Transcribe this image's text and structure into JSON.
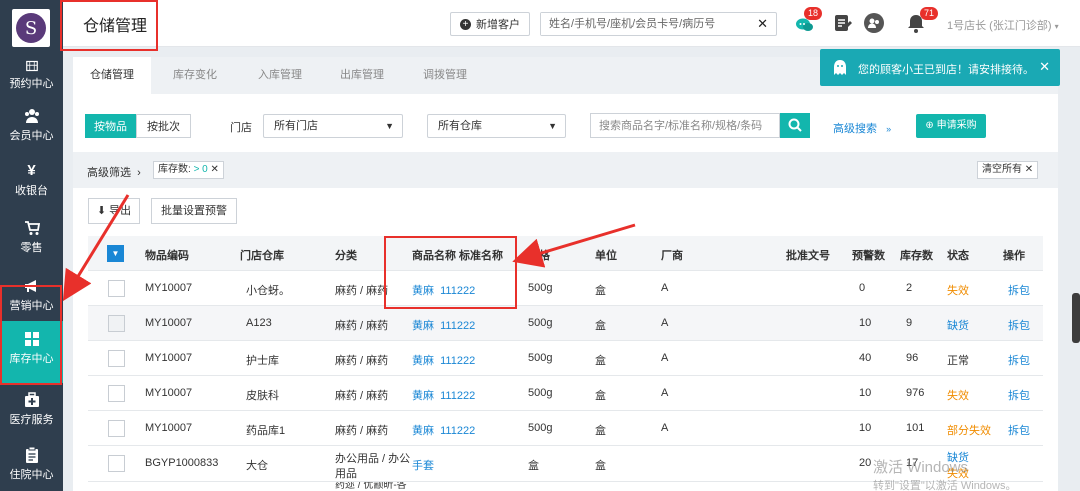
{
  "app": {
    "logo_letter": "S"
  },
  "sidebar": {
    "items": [
      {
        "key": "appointment",
        "label": "预约中心",
        "icon": "calendar-icon"
      },
      {
        "key": "member",
        "label": "会员中心",
        "icon": "users-icon"
      },
      {
        "key": "cashier",
        "label": "收银台",
        "icon": "yen-icon"
      },
      {
        "key": "retail",
        "label": "零售",
        "icon": "cart-icon"
      },
      {
        "key": "marketing",
        "label": "营销中心",
        "icon": "megaphone-icon"
      },
      {
        "key": "inventory",
        "label": "库存中心",
        "icon": "grid-icon",
        "active": true
      },
      {
        "key": "medical",
        "label": "医疗服务",
        "icon": "medkit-icon"
      },
      {
        "key": "inpatient",
        "label": "住院中心",
        "icon": "clipboard-icon"
      }
    ]
  },
  "header": {
    "title": "仓储管理",
    "add_customer": "新增客户",
    "search_placeholder": "姓名/手机号/座机/会员卡号/病历号",
    "chat_badge": "18",
    "bell_badge": "71",
    "user": "1号店长 (张江门诊部)"
  },
  "toast": {
    "message": "您的顾客小王已到店！请安排接待。"
  },
  "tabs": [
    "仓储管理",
    "库存变化",
    "入库管理",
    "出库管理",
    "调拨管理"
  ],
  "toolbar": {
    "by_item": "按物品",
    "by_batch": "按批次",
    "store_label": "门店",
    "store_select": "所有门店",
    "warehouse_select": "所有仓库",
    "product_search_placeholder": "搜索商品名字/标准名称/规格/条码",
    "advanced_search": "高级搜索",
    "apply_purchase": "申请采购"
  },
  "filter": {
    "label": "高级筛选",
    "chip_key": "库存数:",
    "chip_value": "> 0",
    "clear_all": "清空所有"
  },
  "actions": {
    "export": "导出",
    "batch_alert": "批量设置预警"
  },
  "table": {
    "headers": [
      "物品编码",
      "门店仓库",
      "分类",
      "商品名称 标准名称",
      "规格",
      "单位",
      "厂商",
      "批准文号",
      "预警数",
      "库存数",
      "状态",
      "操作"
    ],
    "rows": [
      {
        "code": "MY10007",
        "store": "小仓蚜。",
        "category": "麻药 / 麻药",
        "name": "黄麻",
        "std_name": "111222",
        "spec": "500g",
        "unit": "盒",
        "vendor": "A",
        "approval": "",
        "alert": "0",
        "stock": "2",
        "status": "失效",
        "status_color": "#f08c00",
        "op": "拆包"
      },
      {
        "code": "MY10007",
        "store": "A123",
        "category": "麻药 / 麻药",
        "name": "黄麻",
        "std_name": "111222",
        "spec": "500g",
        "unit": "盒",
        "vendor": "A",
        "approval": "",
        "alert": "10",
        "stock": "9",
        "status": "缺货",
        "status_color": "#1a87d5",
        "op": "拆包"
      },
      {
        "code": "MY10007",
        "store": "护士库",
        "category": "麻药 / 麻药",
        "name": "黄麻",
        "std_name": "111222",
        "spec": "500g",
        "unit": "盒",
        "vendor": "A",
        "approval": "",
        "alert": "40",
        "stock": "96",
        "status": "正常",
        "status_color": "#333333",
        "op": "拆包"
      },
      {
        "code": "MY10007",
        "store": "皮肤科",
        "category": "麻药 / 麻药",
        "name": "黄麻",
        "std_name": "111222",
        "spec": "500g",
        "unit": "盒",
        "vendor": "A",
        "approval": "",
        "alert": "10",
        "stock": "976",
        "status": "失效",
        "status_color": "#f08c00",
        "op": "拆包"
      },
      {
        "code": "MY10007",
        "store": "药品库1",
        "category": "麻药 / 麻药",
        "name": "黄麻",
        "std_name": "111222",
        "spec": "500g",
        "unit": "盒",
        "vendor": "A",
        "approval": "",
        "alert": "10",
        "stock": "101",
        "status": "部分失效",
        "status_color": "#f08c00",
        "op": "拆包"
      },
      {
        "code": "BGYP1000833",
        "store": "大仓",
        "category": "办公用品 / 办公",
        "category2": "用品",
        "name": "手套",
        "std_name": "",
        "spec": "盒",
        "unit": "盒",
        "vendor": "",
        "approval": "",
        "alert": "20",
        "stock": "17",
        "status": "缺货",
        "status2": "失效",
        "status_color": "#1a87d5",
        "op": ""
      }
    ],
    "partial_row_text": "药迩 / 优颛昕-各"
  },
  "watermark": {
    "line1": "激活 Windows",
    "line2": "转到\"设置\"以激活 Windows。"
  },
  "colors": {
    "sidebar": "#2f3e4e",
    "accent": "#13b6ad",
    "link": "#1a87d5",
    "warn": "#f08c00",
    "annotation": "#e8302b"
  }
}
